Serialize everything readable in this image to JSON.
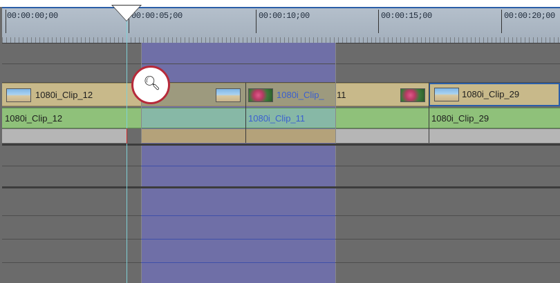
{
  "ruler": {
    "timecodes": [
      "00:00:00;00",
      "00:00:05;00",
      "00:00:10;00",
      "00:00:15;00",
      "00:00:20;00"
    ]
  },
  "tracks": {
    "video": {
      "clips": [
        {
          "name": "1080i_Clip_12",
          "thumb": "beach"
        },
        {
          "name": "1080i_Clip_11",
          "display": "1080i_Clip_",
          "tail": "11",
          "thumb": "flower"
        },
        {
          "name": "1080i_Clip_29",
          "thumb": "beach"
        }
      ]
    },
    "audio": {
      "clips": [
        {
          "name": "1080i_Clip_12"
        },
        {
          "name": "1080i_Clip_11"
        },
        {
          "name": "1080i_Clip_29"
        }
      ]
    }
  },
  "tools": {
    "zoom": {
      "icon": "magnifier-zoom-icon"
    }
  },
  "colors": {
    "range": "#6f6fa7",
    "video_clip": "#c8b98a",
    "audio_clip": "#8fc17a",
    "cursor": "#7ed0d6",
    "zoom_ring": "#b62a3a"
  }
}
